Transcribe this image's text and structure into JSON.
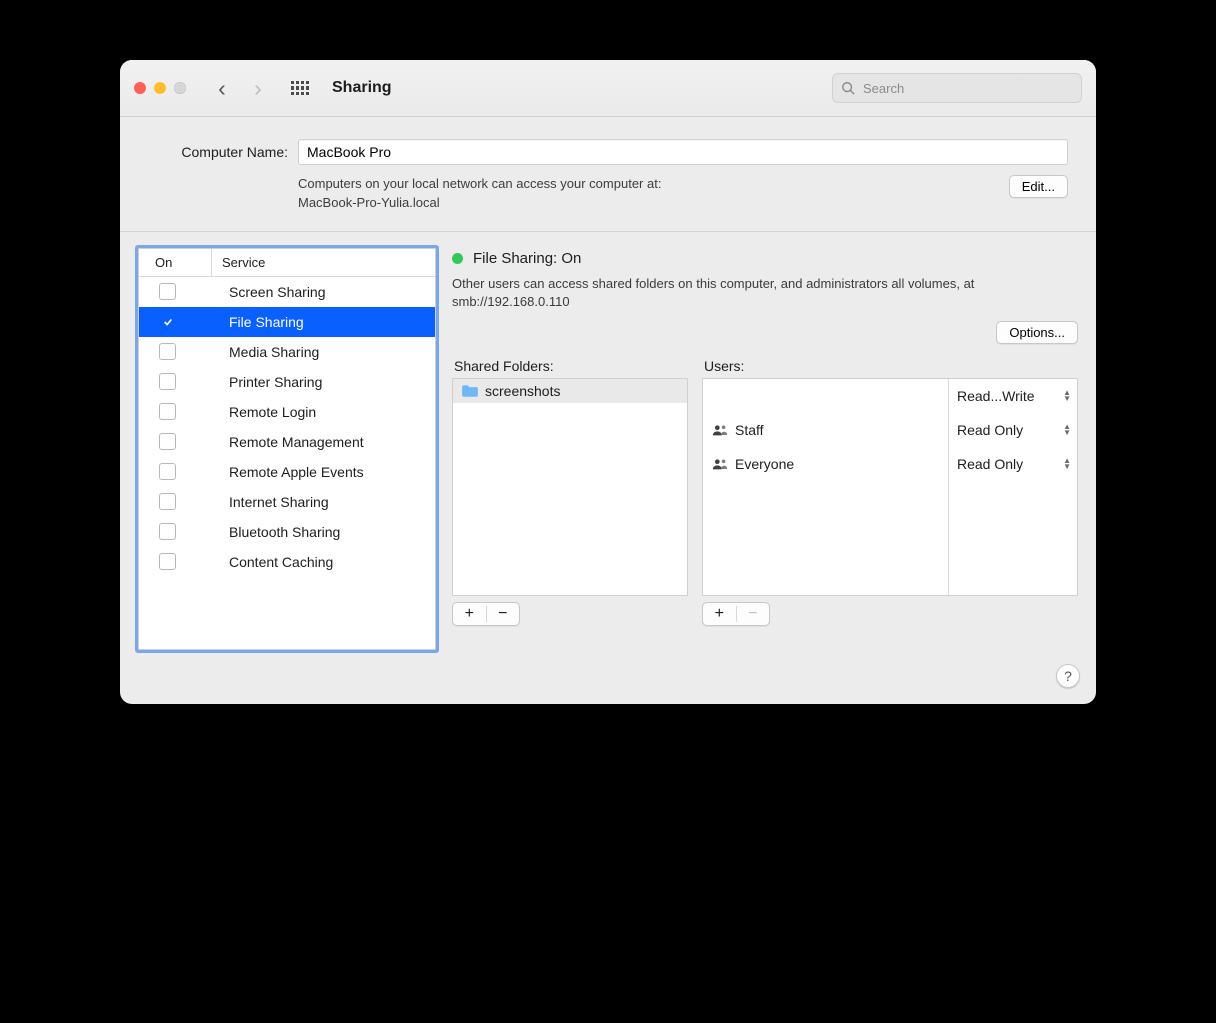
{
  "toolbar": {
    "title": "Sharing",
    "search_placeholder": "Search"
  },
  "top": {
    "name_label": "Computer Name:",
    "name_value": "MacBook Pro",
    "info_line1": "Computers on your local network can access your computer at:",
    "info_line2": "MacBook-Pro-Yulia.local",
    "edit_label": "Edit..."
  },
  "services": {
    "header_on": "On",
    "header_service": "Service",
    "items": [
      {
        "label": "Screen Sharing",
        "checked": false,
        "selected": false
      },
      {
        "label": "File Sharing",
        "checked": true,
        "selected": true
      },
      {
        "label": "Media Sharing",
        "checked": false,
        "selected": false
      },
      {
        "label": "Printer Sharing",
        "checked": false,
        "selected": false
      },
      {
        "label": "Remote Login",
        "checked": false,
        "selected": false
      },
      {
        "label": "Remote Management",
        "checked": false,
        "selected": false
      },
      {
        "label": "Remote Apple Events",
        "checked": false,
        "selected": false
      },
      {
        "label": "Internet Sharing",
        "checked": false,
        "selected": false
      },
      {
        "label": "Bluetooth Sharing",
        "checked": false,
        "selected": false
      },
      {
        "label": "Content Caching",
        "checked": false,
        "selected": false
      }
    ]
  },
  "detail": {
    "status_title": "File Sharing: On",
    "status_desc": "Other users can access shared folders on this computer, and administrators all volumes, at smb://192.168.0.110",
    "options_label": "Options...",
    "folders_label": "Shared Folders:",
    "users_label": "Users:",
    "folders": [
      {
        "label": "screenshots",
        "selected": true
      }
    ],
    "users": [
      {
        "label": "",
        "perm": "Read...Write",
        "icon": "none"
      },
      {
        "label": "Staff",
        "perm": "Read Only",
        "icon": "group"
      },
      {
        "label": "Everyone",
        "perm": "Read Only",
        "icon": "group"
      }
    ]
  }
}
